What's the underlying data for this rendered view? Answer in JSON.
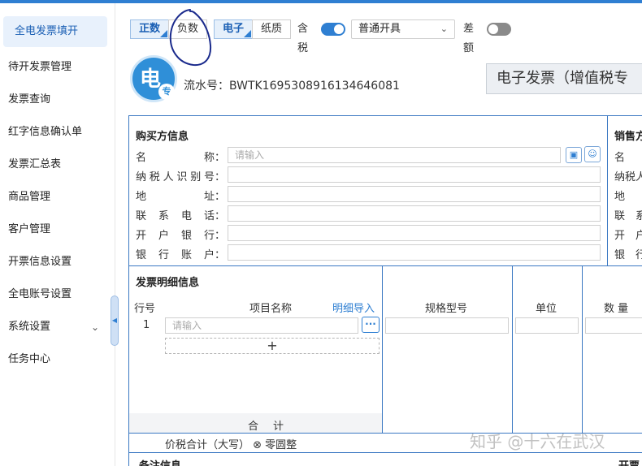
{
  "sidebar": {
    "items": [
      {
        "label": "全电发票填开",
        "active": true
      },
      {
        "label": "待开发票管理"
      },
      {
        "label": "发票查询"
      },
      {
        "label": "红字信息确认单"
      },
      {
        "label": "发票汇总表"
      },
      {
        "label": "商品管理"
      },
      {
        "label": "客户管理"
      },
      {
        "label": "开票信息设置"
      },
      {
        "label": "全电账号设置"
      },
      {
        "label": "系统设置",
        "has_submenu": true
      },
      {
        "label": "任务中心"
      }
    ]
  },
  "toolbar": {
    "positive": "正数",
    "negative": "负数",
    "electronic": "电子",
    "paper": "纸质",
    "tax_included": "含税",
    "tax_included_on": true,
    "issue_type": "普通开具",
    "difference": "差额",
    "difference_on": false
  },
  "header": {
    "logo_big": "电",
    "logo_small": "专",
    "serial": "流水号：BWTK1695308916134646081",
    "invoice_title": "电子发票（增值税专"
  },
  "buyer": {
    "title": "购买方信息",
    "fields": [
      {
        "label": [
          "名",
          "称："
        ],
        "placeholder": "请输入"
      },
      {
        "label": [
          "纳",
          "税",
          "人",
          "识",
          "别",
          "号："
        ],
        "placeholder": ""
      },
      {
        "label": [
          "地",
          "址："
        ],
        "placeholder": ""
      },
      {
        "label": [
          "联",
          "系",
          "电",
          "话："
        ],
        "placeholder": ""
      },
      {
        "label": [
          "开",
          "户",
          "银",
          "行："
        ],
        "placeholder": ""
      },
      {
        "label": [
          "银",
          "行",
          "账",
          "户："
        ],
        "placeholder": ""
      }
    ]
  },
  "seller": {
    "title": "销售方",
    "labels": [
      "名",
      "纳税人",
      "地",
      "联　系",
      "开　户",
      "银　行"
    ]
  },
  "details": {
    "title": "发票明细信息",
    "col_row_no": "行号",
    "col_item_name": "项目名称",
    "import_link": "明细导入",
    "col_spec": "规格型号",
    "col_unit": "单位",
    "col_qty": "数 量",
    "row1_no": "1",
    "row1_placeholder": "请输入",
    "add_symbol": "+",
    "sum_label": "合计",
    "total_label": "价税合计（大写） ⊗ 零圆整"
  },
  "footer": {
    "remark_title": "备注信息",
    "issuer_title": "开票"
  },
  "watermark": "知乎 @十六在武汉",
  "colors": {
    "accent": "#2f7fd2",
    "border": "#3a78c2",
    "annotation": "#1a2a8c"
  }
}
